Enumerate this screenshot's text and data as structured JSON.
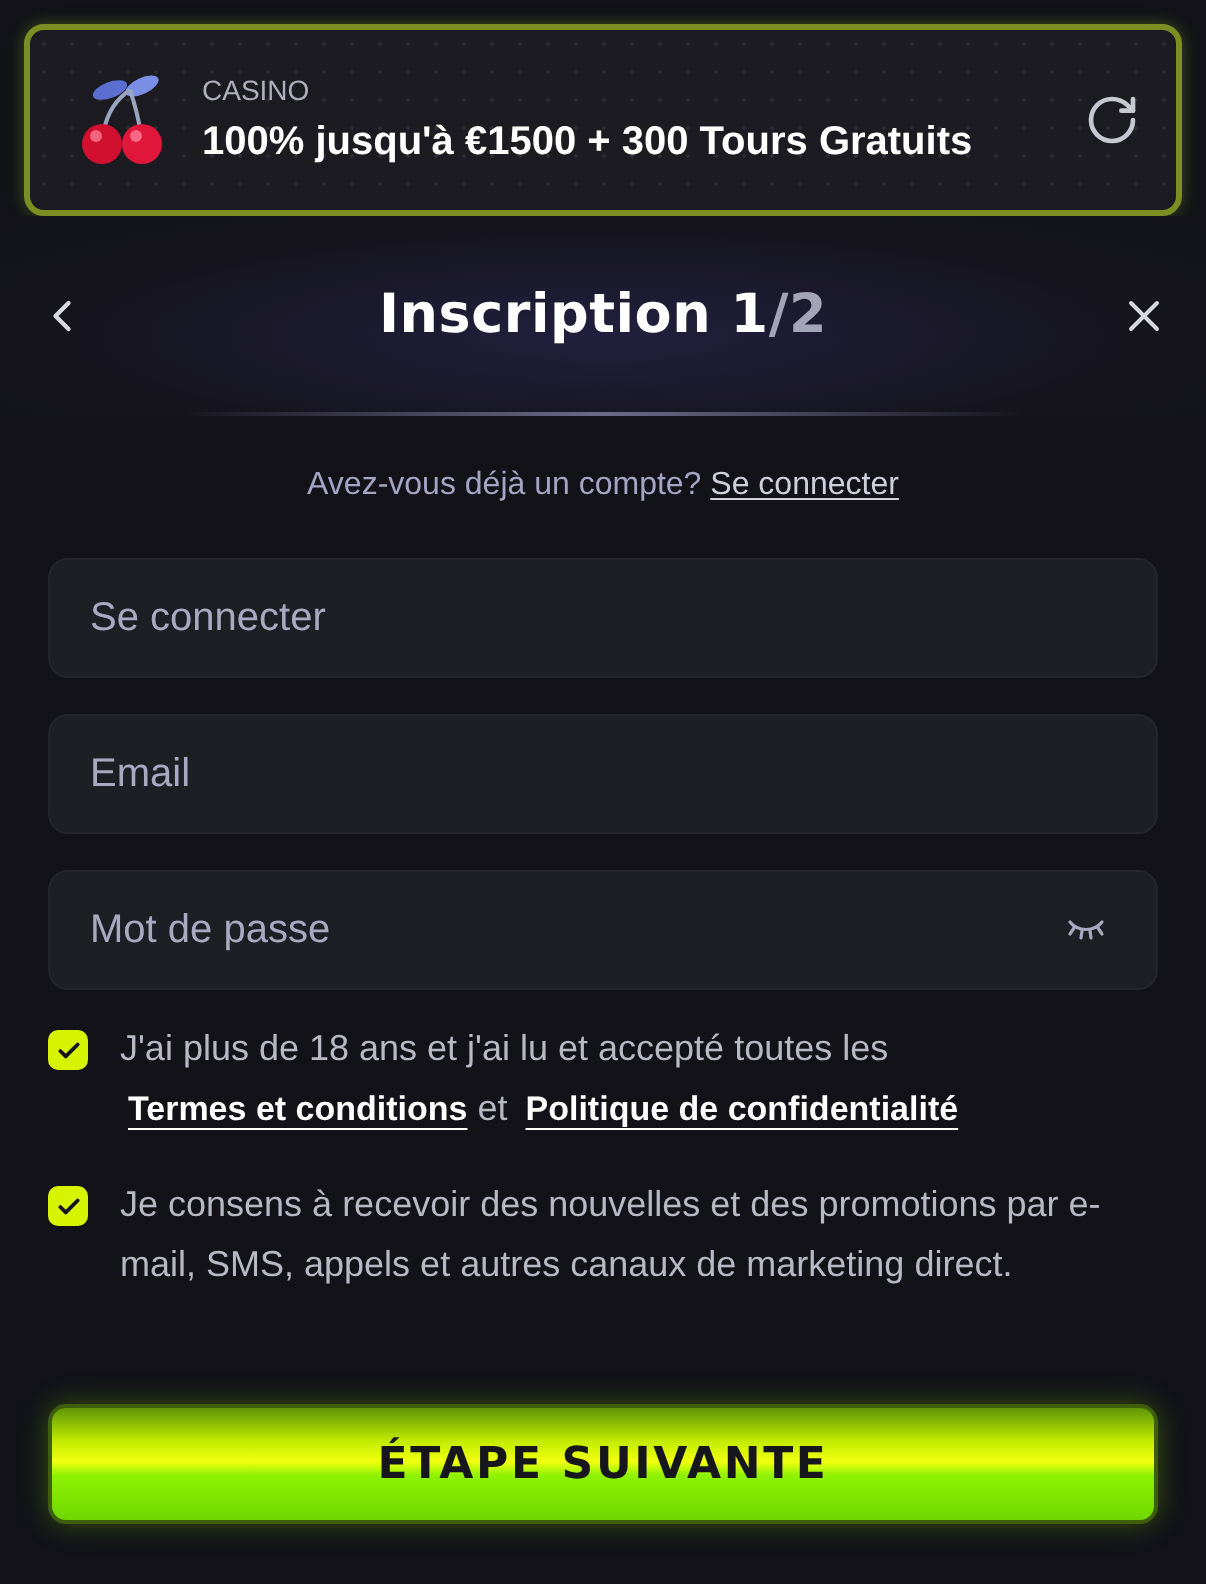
{
  "promo": {
    "category": "CASINO",
    "offer": "100% jusqu'à €1500 + 300 Tours Gratuits"
  },
  "header": {
    "title": "Inscription 1",
    "title_suffix": "/2"
  },
  "login_prompt": {
    "text": "Avez-vous déjà un compte?",
    "link": "Se connecter"
  },
  "fields": [
    {
      "kind": "text",
      "placeholder": "Se connecter"
    },
    {
      "kind": "email",
      "placeholder": "Email"
    },
    {
      "kind": "password",
      "placeholder": "Mot de passe"
    }
  ],
  "consents": [
    {
      "checked": true,
      "parts": [
        {
          "kind": "text",
          "text": "J'ai plus de 18 ans et j'ai lu et accepté toutes les"
        },
        {
          "kind": "link",
          "text": "Termes et conditions"
        },
        {
          "kind": "text",
          "text": "et"
        },
        {
          "kind": "link",
          "text": "Politique de confidentialité"
        }
      ]
    },
    {
      "checked": true,
      "parts": [
        {
          "kind": "text",
          "text": "Je consens à recevoir des nouvelles et des promotions par e-mail, SMS, appels et autres canaux de marketing direct."
        }
      ]
    }
  ],
  "next_button": {
    "label": "ÉTAPE SUIVANTE"
  }
}
